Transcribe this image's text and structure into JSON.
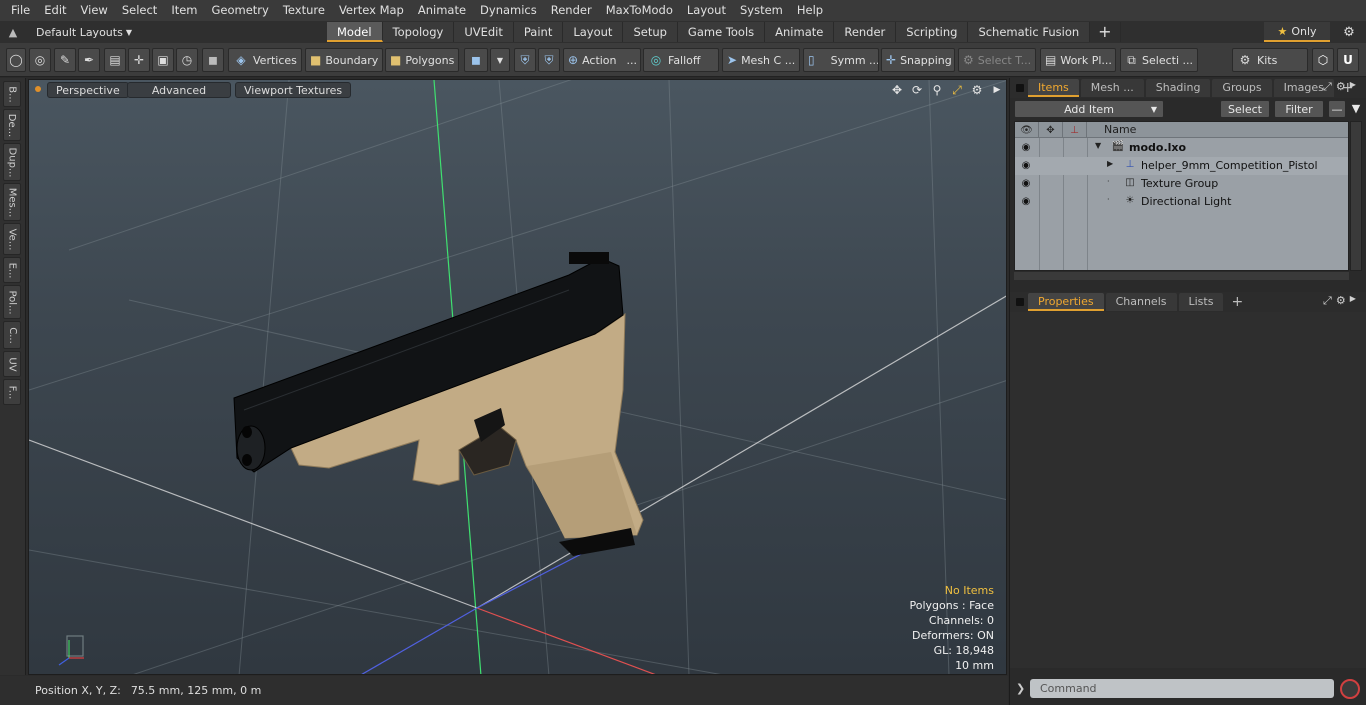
{
  "menu": [
    "File",
    "Edit",
    "View",
    "Select",
    "Item",
    "Geometry",
    "Texture",
    "Vertex Map",
    "Animate",
    "Dynamics",
    "Render",
    "MaxToModo",
    "Layout",
    "System",
    "Help"
  ],
  "layouts": {
    "label": "Default Layouts",
    "tabs": [
      "Model",
      "Topology",
      "UVEdit",
      "Paint",
      "Layout",
      "Setup",
      "Game Tools",
      "Animate",
      "Render",
      "Scripting",
      "Schematic Fusion"
    ],
    "active_tab": "Model",
    "only_label": "Only"
  },
  "toolbar": {
    "vertices": "Vertices",
    "boundary": "Boundary",
    "polygons": "Polygons",
    "action": "Action",
    "falloff": "Falloff",
    "mesh_c": "Mesh C ...",
    "symm": "Symm ...",
    "snapping": "Snapping",
    "select_t": "Select T...",
    "work_pl": "Work Pl...",
    "selecti": "Selecti ...",
    "kits": "Kits"
  },
  "left_tabs": [
    "B...",
    "De...",
    "Dup...",
    "Mes...",
    "Ve...",
    "E...",
    "Pol...",
    "C...",
    "UV",
    "F..."
  ],
  "viewport": {
    "buttons": [
      "Perspective",
      "Advanced",
      "Viewport Textures"
    ],
    "info_highlight": "No Items",
    "info_lines": [
      "Polygons : Face",
      "Channels: 0",
      "Deformers: ON",
      "GL: 18,948",
      "10 mm"
    ]
  },
  "status": {
    "label": "Position X, Y, Z:",
    "value": "75.5 mm, 125 mm, 0 m"
  },
  "items_panel": {
    "tabs": [
      "Items",
      "Mesh ...",
      "Shading",
      "Groups",
      "Images"
    ],
    "active_tab": "Items",
    "add_item": "Add Item",
    "select": "Select",
    "filter": "Filter",
    "name_header": "Name",
    "rows": [
      {
        "label": "modo.lxo",
        "bold": true
      },
      {
        "label": "helper_9mm_Competition_Pistol"
      },
      {
        "label": "Texture Group"
      },
      {
        "label": "Directional Light"
      }
    ]
  },
  "properties_panel": {
    "tabs": [
      "Properties",
      "Channels",
      "Lists"
    ],
    "active_tab": "Properties"
  },
  "command": {
    "placeholder": "Command"
  },
  "colors": {
    "accent": "#e0a030",
    "pistol_slide": "#101214",
    "pistol_frame": "#c2ab85"
  }
}
